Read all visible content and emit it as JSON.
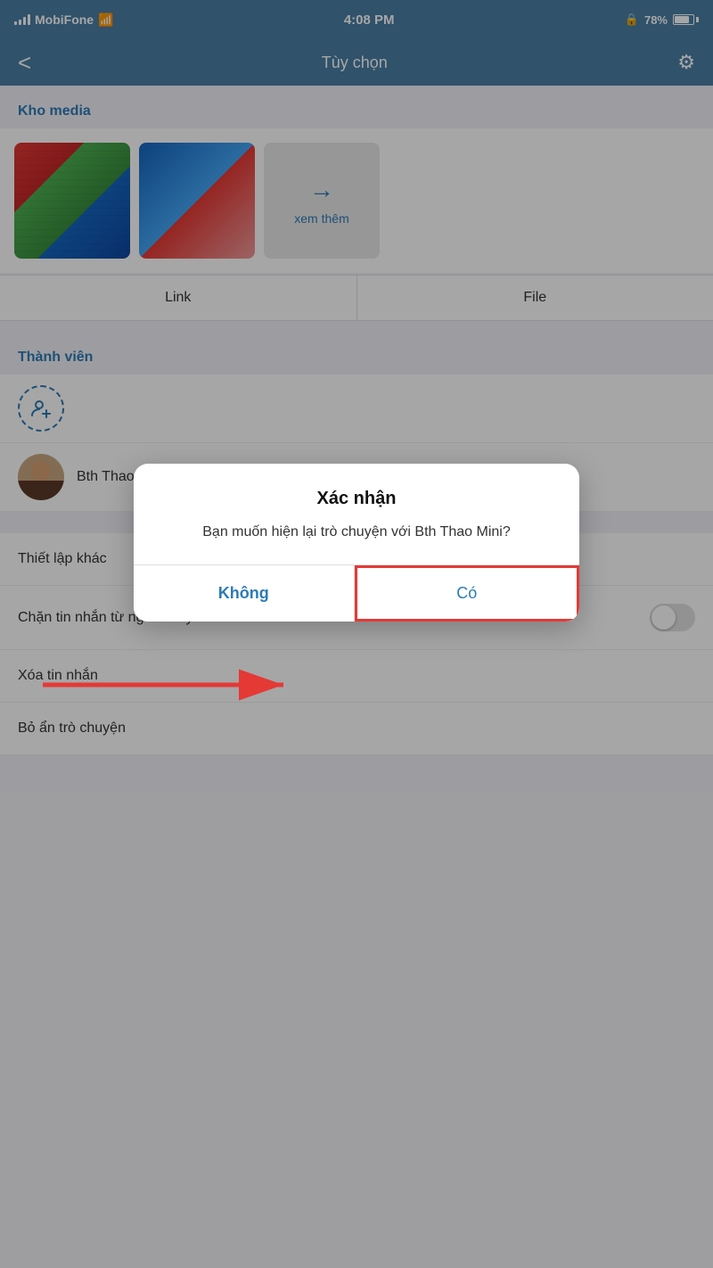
{
  "statusBar": {
    "carrier": "MobiFone",
    "time": "4:08 PM",
    "battery": "78%",
    "locked": true
  },
  "navBar": {
    "backLabel": "<",
    "title": "Tùy chọn",
    "gearLabel": "⚙"
  },
  "mediaSection": {
    "header": "Kho media",
    "viewMoreLabel": "xem thêm"
  },
  "tabs": [
    {
      "label": "Link"
    },
    {
      "label": "File"
    }
  ],
  "membersSection": {
    "header": "Thành viên",
    "addMemberLabel": "+",
    "members": [
      {
        "name": "Bth Thao Mini"
      }
    ]
  },
  "settingsSection": {
    "header": "Thiết lập khác",
    "rows": [
      {
        "label": "Chặn tin nhắn từ người này",
        "hasToggle": true
      },
      {
        "label": "Xóa tin nhắn",
        "hasToggle": false
      },
      {
        "label": "Bỏ ẩn trò chuyện",
        "hasToggle": false
      }
    ]
  },
  "dialog": {
    "title": "Xác nhận",
    "message": "Bạn muốn hiện lại trò chuyện với Bth Thao Mini?",
    "cancelLabel": "Không",
    "confirmLabel": "Có"
  }
}
